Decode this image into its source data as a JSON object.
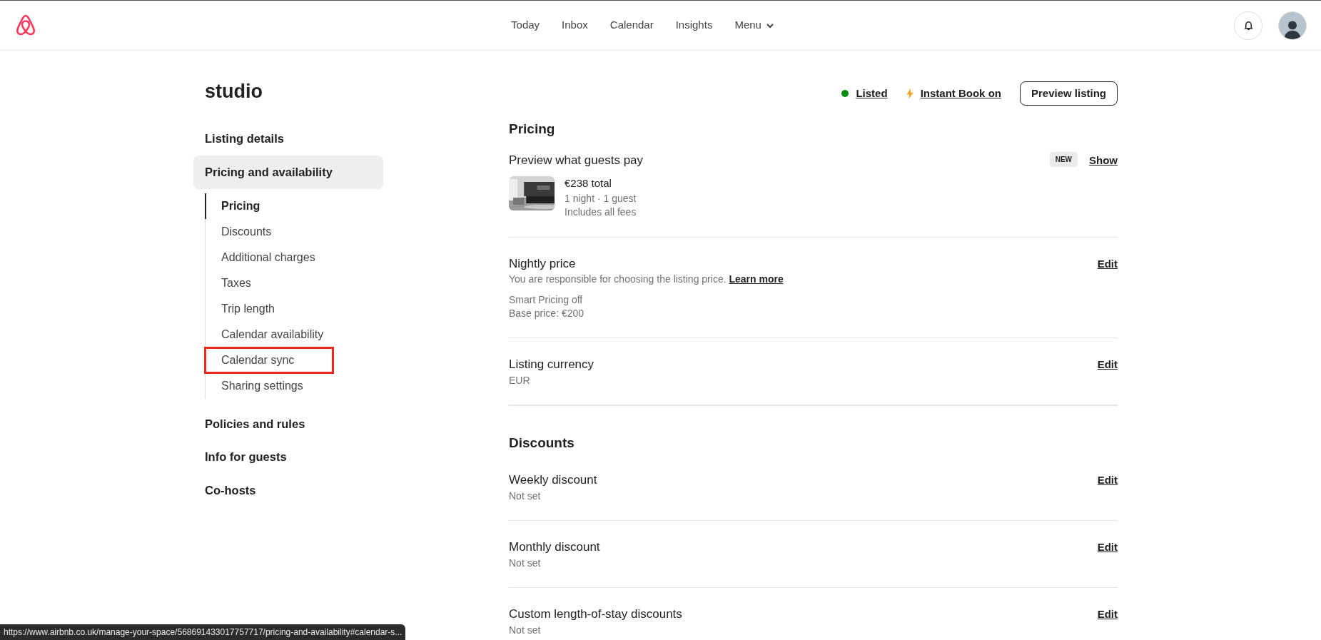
{
  "nav": {
    "items": [
      {
        "label": "Today"
      },
      {
        "label": "Inbox"
      },
      {
        "label": "Calendar"
      },
      {
        "label": "Insights"
      },
      {
        "label": "Menu",
        "kind": "dropdown"
      }
    ]
  },
  "listing": {
    "title": "studio",
    "status": {
      "label": "Listed",
      "color": "#008a05"
    },
    "instant_book": {
      "label": "Instant Book on"
    },
    "preview_button": "Preview listing"
  },
  "sidebar": {
    "sections": [
      {
        "label": "Listing details",
        "selected": false
      },
      {
        "label": "Pricing and availability",
        "selected": true,
        "children": [
          {
            "label": "Pricing",
            "selected": true,
            "highlighted": false
          },
          {
            "label": "Discounts",
            "selected": false,
            "highlighted": false
          },
          {
            "label": "Additional charges",
            "selected": false,
            "highlighted": false
          },
          {
            "label": "Taxes",
            "selected": false,
            "highlighted": false
          },
          {
            "label": "Trip length",
            "selected": false,
            "highlighted": false
          },
          {
            "label": "Calendar availability",
            "selected": false,
            "highlighted": false
          },
          {
            "label": "Calendar sync",
            "selected": false,
            "highlighted": true
          },
          {
            "label": "Sharing settings",
            "selected": false,
            "highlighted": false
          }
        ]
      },
      {
        "label": "Policies and rules",
        "selected": false
      },
      {
        "label": "Info for guests",
        "selected": false
      },
      {
        "label": "Co-hosts",
        "selected": false
      }
    ]
  },
  "sections": [
    {
      "heading": "Pricing",
      "rows": [
        {
          "kind": "preview",
          "title": "Preview what guests pay",
          "badge": "NEW",
          "action": "Show",
          "total": "€238 total",
          "details": [
            "1 night · 1 guest",
            "Includes all fees"
          ]
        },
        {
          "kind": "setting",
          "title": "Nightly price",
          "description": "You are responsible for choosing the listing price.",
          "link": "Learn more",
          "notes": [
            "Smart Pricing off",
            "Base price: €200"
          ],
          "action": "Edit"
        },
        {
          "kind": "setting",
          "title": "Listing currency",
          "notes": [
            "EUR"
          ],
          "action": "Edit"
        }
      ]
    },
    {
      "heading": "Discounts",
      "rows": [
        {
          "kind": "setting",
          "title": "Weekly discount",
          "notes": [
            "Not set"
          ],
          "action": "Edit"
        },
        {
          "kind": "setting",
          "title": "Monthly discount",
          "notes": [
            "Not set"
          ],
          "action": "Edit"
        },
        {
          "kind": "setting",
          "title": "Custom length-of-stay discounts",
          "notes": [
            "Not set"
          ],
          "action": "Edit"
        }
      ]
    }
  ],
  "status_url": "https://www.airbnb.co.uk/manage-your-space/568691433017757717/pricing-and-availability#calendar-s..."
}
